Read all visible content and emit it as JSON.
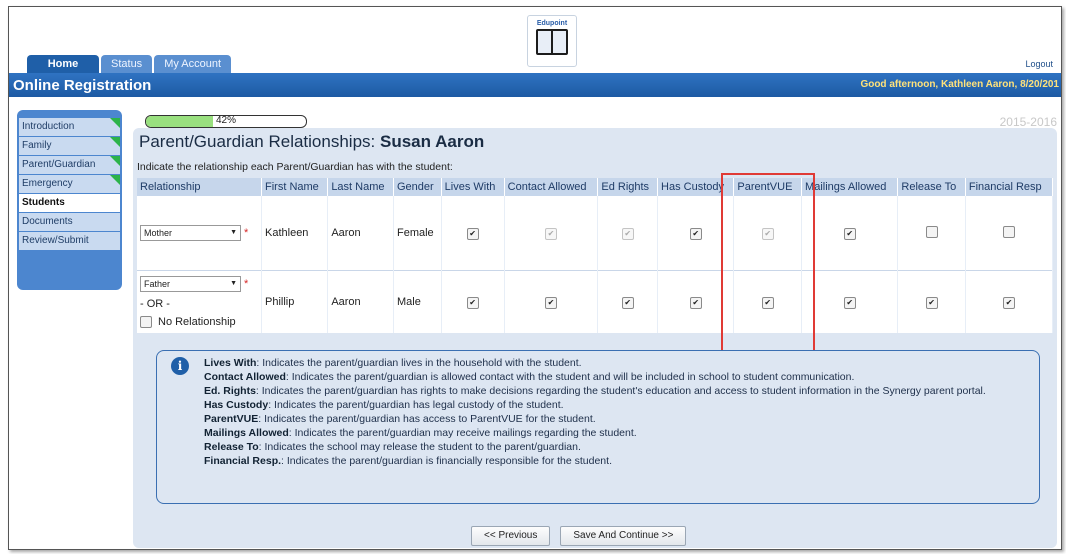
{
  "header": {
    "logo_brand": "Edupoint",
    "tabs": [
      {
        "label": "Home"
      },
      {
        "label": "Status"
      },
      {
        "label": "My Account"
      }
    ],
    "logout": "Logout",
    "app_title": "Online Registration",
    "greeting": "Good afternoon, Kathleen Aaron, 8/20/201"
  },
  "sidebar": {
    "items": [
      {
        "label": "Introduction"
      },
      {
        "label": "Family"
      },
      {
        "label": "Parent/Guardian"
      },
      {
        "label": "Emergency"
      },
      {
        "label": "Students"
      },
      {
        "label": "Documents"
      },
      {
        "label": "Review/Submit"
      }
    ]
  },
  "progress": {
    "value": 0.42,
    "label": "42%"
  },
  "school_year": "2015-2016",
  "page": {
    "title_prefix": "Parent/Guardian Relationships:",
    "student_name": "Susan Aaron",
    "instruction": "Indicate the relationship each Parent/Guardian has with the student:"
  },
  "table": {
    "columns": [
      "Relationship",
      "First Name",
      "Last Name",
      "Gender",
      "Lives With",
      "Contact Allowed",
      "Ed Rights",
      "Has Custody",
      "ParentVUE",
      "Mailings Allowed",
      "Release To",
      "Financial Resp"
    ],
    "rows": [
      {
        "relationship": "Mother",
        "first_name": "Kathleen",
        "last_name": "Aaron",
        "gender": "Female",
        "lives_with": true,
        "contact_allowed": true,
        "ed_rights": true,
        "has_custody": true,
        "parentvue": true,
        "mailings_allowed": true,
        "release_to": false,
        "financial_resp": false
      },
      {
        "relationship": "Father",
        "first_name": "Phillip",
        "last_name": "Aaron",
        "gender": "Male",
        "lives_with": true,
        "contact_allowed": true,
        "ed_rights": true,
        "has_custody": true,
        "parentvue": true,
        "mailings_allowed": true,
        "release_to": true,
        "financial_resp": true,
        "or_text": "- OR -",
        "no_relationship_label": "No Relationship"
      }
    ]
  },
  "legend": {
    "items": [
      {
        "term": "Lives With",
        "desc": ": Indicates the parent/guardian lives in the household with the student."
      },
      {
        "term": "Contact Allowed",
        "desc": ": Indicates the parent/guardian is allowed contact with the student and will be included in school to student communication."
      },
      {
        "term": "Ed. Rights",
        "desc": ": Indicates the parent/guardian has rights to make decisions regarding the student's education and access to student information in the Synergy parent portal."
      },
      {
        "term": "Has Custody",
        "desc": ": Indicates the parent/guardian has legal custody of the student."
      },
      {
        "term": "ParentVUE",
        "desc": ": Indicates the parent/guardian has access to ParentVUE for the student."
      },
      {
        "term": "Mailings Allowed",
        "desc": ": Indicates the parent/guardian may receive mailings regarding the student."
      },
      {
        "term": "Release To",
        "desc": ": Indicates the school may release the student to the parent/guardian."
      },
      {
        "term": "Financial Resp.",
        "desc": ": Indicates the parent/guardian is financially responsible for the student."
      }
    ]
  },
  "buttons": {
    "previous": "<< Previous",
    "save_continue": "Save And Continue >>"
  },
  "colors": {
    "highlight_box": "#e03a35",
    "header_blue": "#1f5fa8",
    "progress_fill": "#99e07f"
  }
}
